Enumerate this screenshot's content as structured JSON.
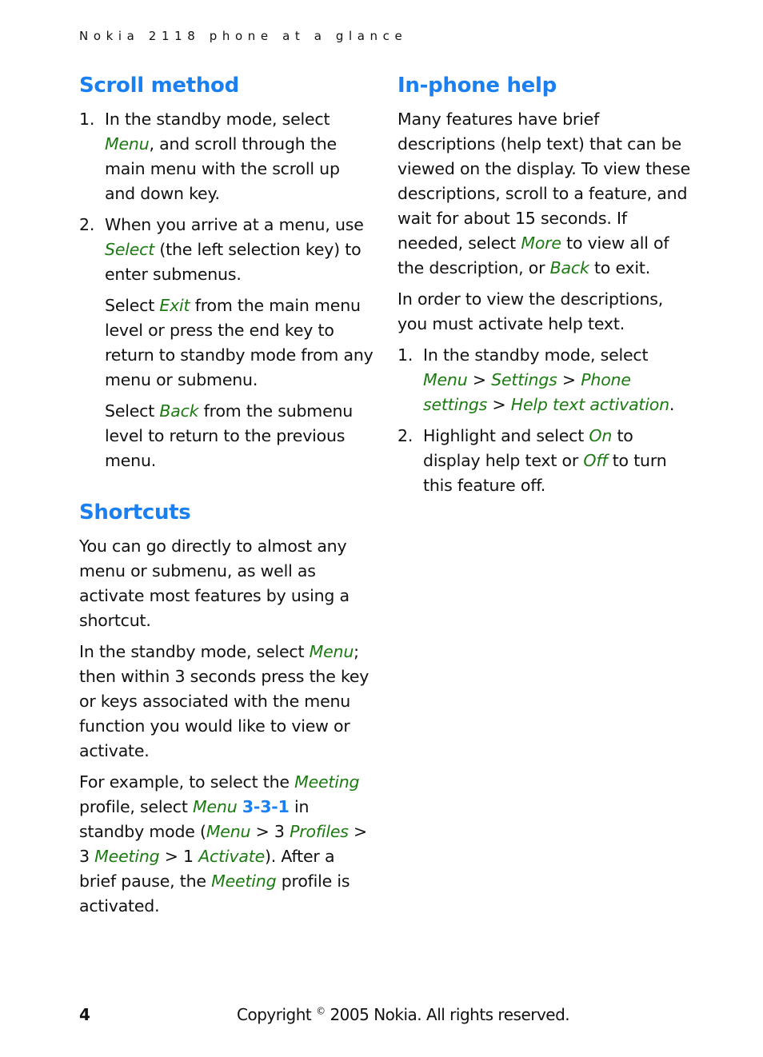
{
  "header": {
    "running_title": "Nokia 2118 phone at a glance"
  },
  "scroll_method": {
    "title": "Scroll method",
    "steps": [
      {
        "num": "1.",
        "t1": "In the standby mode, select ",
        "k1": "Menu",
        "t2": ", and scroll through the main menu with the scroll up and down key."
      },
      {
        "num": "2.",
        "t1": "When you arrive at a menu, use ",
        "k1": "Select",
        "t2": " (the left selection key) to enter submenus."
      }
    ],
    "note1": {
      "t1": "Select ",
      "k1": "Exit",
      "t2": " from the main menu level or press the end key to return to standby mode from any menu or submenu."
    },
    "note2": {
      "t1": "Select ",
      "k1": "Back",
      "t2": " from the submenu level to return to the previous menu."
    }
  },
  "shortcuts": {
    "title": "Shortcuts",
    "p1": "You can go directly to almost any menu or submenu, as well as activate most features by using a shortcut.",
    "p2": {
      "t1": "In the standby mode, select ",
      "k1": "Menu",
      "t2": "; then within 3 seconds press the key or keys associated with the menu function you would like to view or activate."
    },
    "p3": {
      "t1": "For example, to select the ",
      "k1": "Meeting",
      "t2": " profile, select ",
      "k2": "Menu",
      "code": "3-3-1",
      "t3": " in standby mode (",
      "k3": "Menu",
      "t4": " > 3 ",
      "k4": "Profiles",
      "t5": " > 3 ",
      "k5": "Meeting",
      "t6": " > 1 ",
      "k6": "Activate",
      "t7": "). After a brief pause, the ",
      "k7": "Meeting",
      "t8": " profile is activated."
    }
  },
  "inphone_help": {
    "title": "In-phone help",
    "p1": {
      "t1": "Many features have brief descriptions (help text) that can be viewed on the display. To view these descriptions, scroll to a feature, and wait for about 15 seconds. If needed, select ",
      "k1": "More",
      "t2": " to view all of the description, or ",
      "k2": "Back",
      "t3": " to exit."
    },
    "p2": "In order to view the descriptions, you must activate help text.",
    "steps": [
      {
        "num": "1.",
        "t1": "In the standby mode, select ",
        "k1": "Menu",
        "t2": " > ",
        "k2": "Settings",
        "t3": " > ",
        "k3": "Phone settings",
        "t4": " > ",
        "k4": "Help text activation",
        "t5": "."
      },
      {
        "num": "2.",
        "t1": "Highlight and select ",
        "k1": "On",
        "t2": " to display help text or ",
        "k2": "Off",
        "t3": " to turn this feature off."
      }
    ]
  },
  "footer": {
    "page_number": "4",
    "copyright_prefix": "Copyright ",
    "copyright_symbol": "©",
    "copyright_rest": " 2005 Nokia. All rights reserved."
  }
}
